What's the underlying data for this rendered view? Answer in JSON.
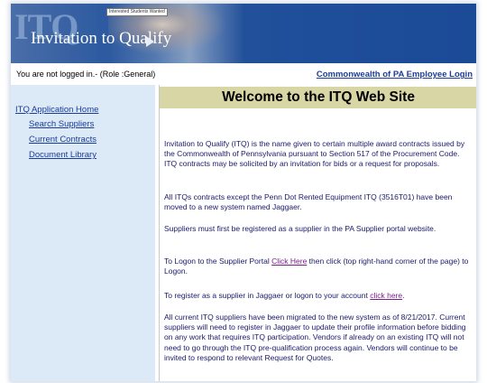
{
  "header": {
    "brand_initials": "ITQ",
    "title": "Invitation to Qualify",
    "tooltip": "Interested Students Wanted"
  },
  "status": {
    "login_state": "You are not logged in.-   (Role :General)",
    "employee_login": "Commonwealth of PA Employee Login"
  },
  "sidebar": {
    "items": [
      {
        "label": "ITQ Application Home"
      },
      {
        "label": "Search Suppliers"
      },
      {
        "label": "Current Contracts"
      },
      {
        "label": "Document Library"
      }
    ]
  },
  "main": {
    "title": "Welcome to the ITQ Web Site",
    "p1": "Invitation to Qualify (ITQ) is the name given to certain multiple award contracts issued by the Commonwealth of Pennsylvania pursuant to Section 517 of the Procurement Code. ITQ contracts may be solicited by an invitation for bids or a request for proposals.",
    "p2": "All ITQs contracts except the Penn Dot Rented Equipment ITQ (3516T01) have been moved to a new system named Jaggaer.",
    "p3": "Suppliers must first be registered as a supplier in the PA Supplier portal website.",
    "p4_before": "To Logon to the Supplier Portal ",
    "p4_link": "Click Here",
    "p4_after": " then click (top right-hand corner of the page) to Logon.",
    "p5_before": "To register as a supplier in Jaggaer or logon to your account ",
    "p5_link": "click here",
    "p5_after": ".",
    "p6": "All current ITQ suppliers have been migrated to the new system as of 8/21/2017. Current suppliers will need to register in Jaggaer to update their profile information before bidding on any work that requires ITQ participation. Vendors if already on an existing ITQ will not need to go through the ITQ pre-qualification process again. Vendors will continue to be invited to respond to relevant Request for Quotes."
  }
}
